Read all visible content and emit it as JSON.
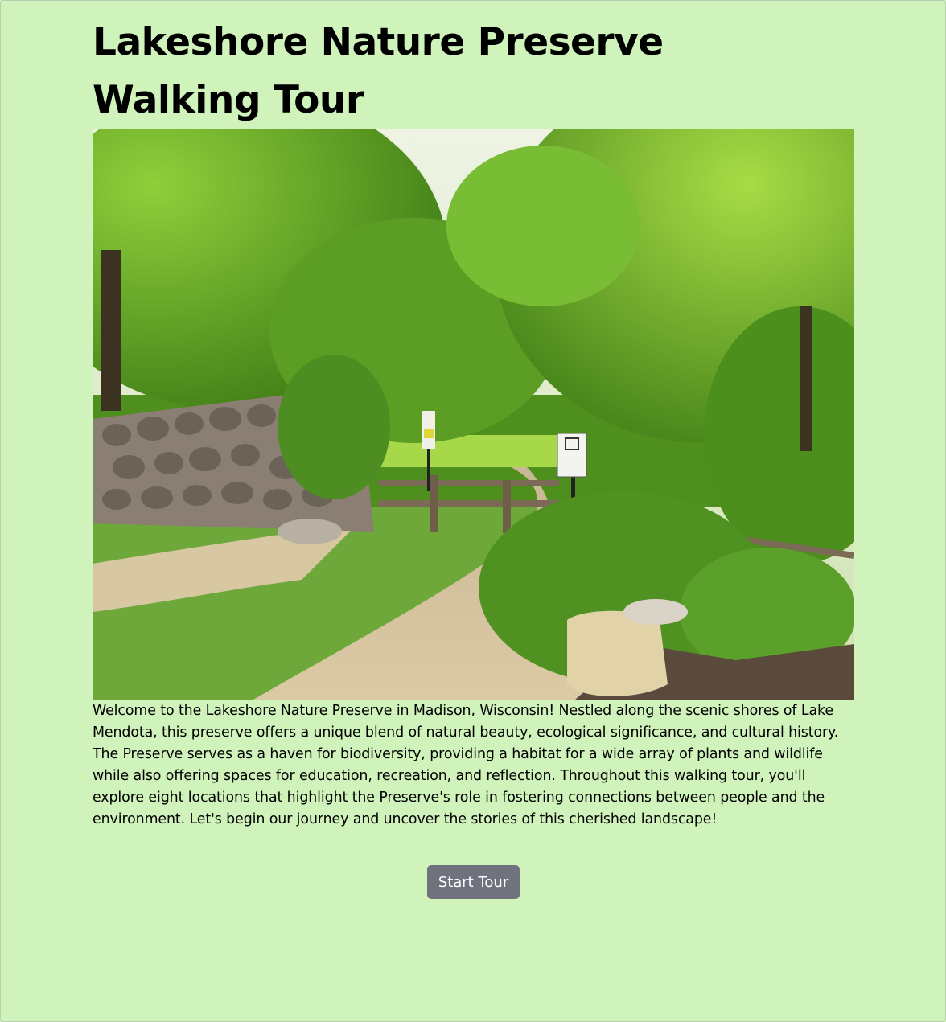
{
  "page": {
    "title": "Lakeshore Nature Preserve Walking Tour",
    "intro": "Welcome to the Lakeshore Nature Preserve in Madison, Wisconsin! Nestled along the scenic shores of Lake Mendota, this preserve offers a unique blend of natural beauty, ecological significance, and cultural history. The Preserve serves as a haven for biodiversity, providing a habitat for a wide array of plants and wildlife while also offering spaces for education, recreation, and reflection. Throughout this walking tour, you'll explore eight locations that highlight the Preserve's role in fostering connections between people and the environment. Let's begin our journey and uncover the stories of this cherished landscape!",
    "start_button": "Start Tour"
  },
  "colors": {
    "background": "#d0f2bb",
    "button": "#70737e",
    "button_text": "#ffffff",
    "text": "#000000"
  }
}
